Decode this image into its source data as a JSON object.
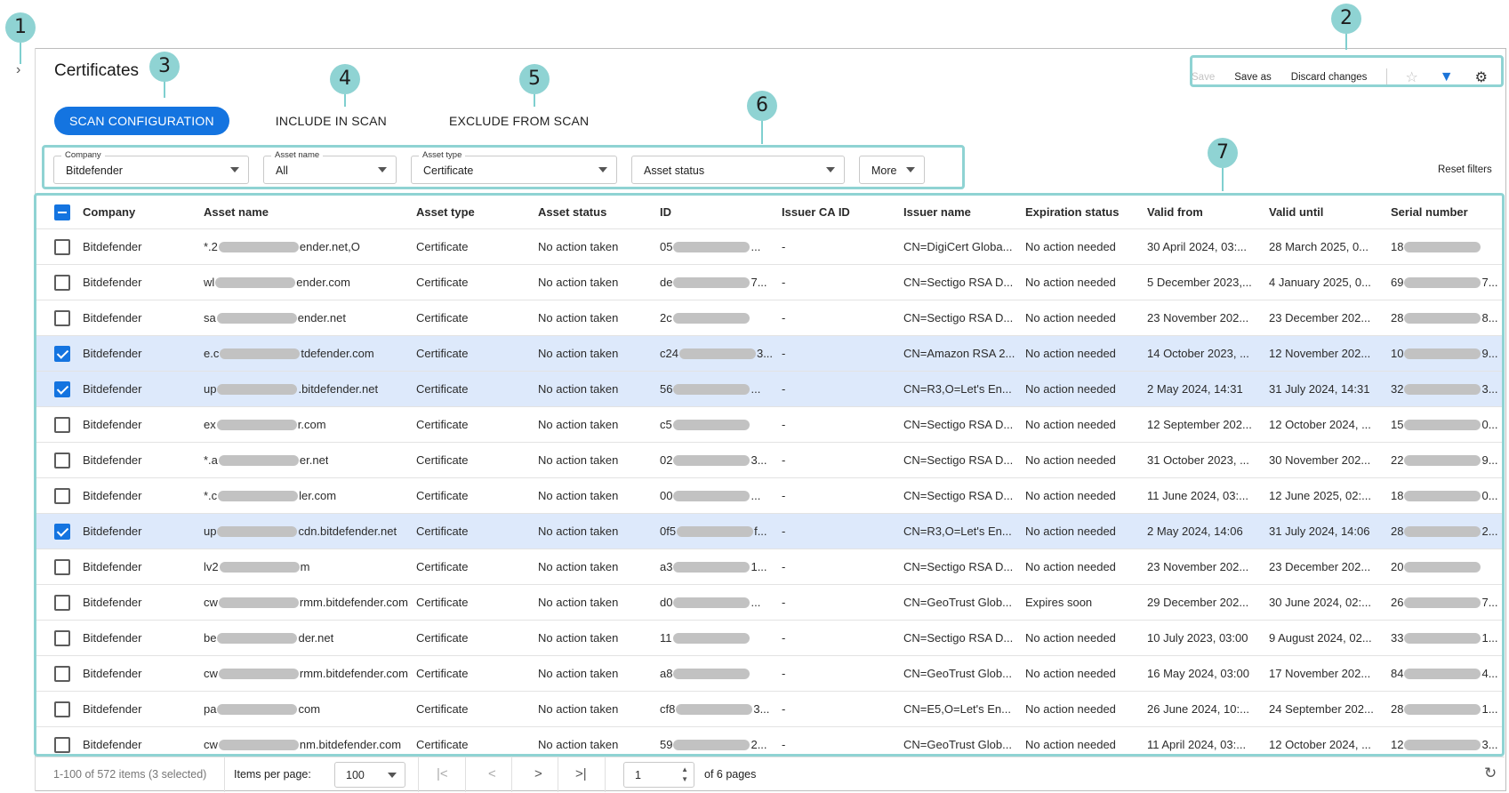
{
  "page": {
    "title": "Certificates"
  },
  "callouts": [
    "1",
    "2",
    "3",
    "4",
    "5",
    "6",
    "7"
  ],
  "toolbar": {
    "save": "Save",
    "save_as": "Save as",
    "discard": "Discard changes",
    "star_icon": "☆",
    "filter_icon": "▼",
    "settings_icon": "⚙"
  },
  "tabs": [
    {
      "label": "SCAN CONFIGURATION",
      "active": true
    },
    {
      "label": "INCLUDE IN SCAN",
      "active": false
    },
    {
      "label": "EXCLUDE FROM SCAN",
      "active": false
    }
  ],
  "filters": {
    "company": {
      "label": "Company",
      "value": "Bitdefender"
    },
    "asset_name": {
      "label": "Asset name",
      "value": "All"
    },
    "asset_type": {
      "label": "Asset type",
      "value": "Certificate"
    },
    "asset_status": {
      "value": "Asset status"
    },
    "more": {
      "value": "More"
    },
    "reset": "Reset filters"
  },
  "columns": [
    "Company",
    "Asset name",
    "Asset type",
    "Asset status",
    "ID",
    "Issuer CA ID",
    "Issuer name",
    "Expiration status",
    "Valid from",
    "Valid until",
    "Serial number"
  ],
  "rows": [
    {
      "selected": false,
      "company": "Bitdefender",
      "name_a": "*.2",
      "name_b": "ender.net,O",
      "type": "Certificate",
      "status": "No action taken",
      "id_a": "05",
      "id_b": "...",
      "issuer_ca": "-",
      "issuer": "CN=DigiCert Globa...",
      "exp": "No action needed",
      "from": "30 April 2024, 03:...",
      "until": "28 March 2025, 0...",
      "serial_a": "18",
      "serial_b": ""
    },
    {
      "selected": false,
      "company": "Bitdefender",
      "name_a": "wl",
      "name_b": "ender.com",
      "type": "Certificate",
      "status": "No action taken",
      "id_a": "de",
      "id_b": "7...",
      "issuer_ca": "-",
      "issuer": "CN=Sectigo RSA D...",
      "exp": "No action needed",
      "from": "5 December 2023,...",
      "until": "4 January 2025, 0...",
      "serial_a": "69",
      "serial_b": "7..."
    },
    {
      "selected": false,
      "company": "Bitdefender",
      "name_a": "sa",
      "name_b": "ender.net",
      "type": "Certificate",
      "status": "No action taken",
      "id_a": "2c",
      "id_b": "",
      "issuer_ca": "-",
      "issuer": "CN=Sectigo RSA D...",
      "exp": "No action needed",
      "from": "23 November 202...",
      "until": "23 December 202...",
      "serial_a": "28",
      "serial_b": "8..."
    },
    {
      "selected": true,
      "company": "Bitdefender",
      "name_a": "e.c",
      "name_b": "tdefender.com",
      "type": "Certificate",
      "status": "No action taken",
      "id_a": "c24",
      "id_b": "3...",
      "issuer_ca": "-",
      "issuer": "CN=Amazon RSA 2...",
      "exp": "No action needed",
      "from": "14 October 2023, ...",
      "until": "12 November 202...",
      "serial_a": "10",
      "serial_b": "9..."
    },
    {
      "selected": true,
      "company": "Bitdefender",
      "name_a": "up",
      "name_b": ".bitdefender.net",
      "type": "Certificate",
      "status": "No action taken",
      "id_a": "56",
      "id_b": "...",
      "issuer_ca": "-",
      "issuer": "CN=R3,O=Let's En...",
      "exp": "No action needed",
      "from": "2 May 2024, 14:31",
      "until": "31 July 2024, 14:31",
      "serial_a": "32",
      "serial_b": "3..."
    },
    {
      "selected": false,
      "company": "Bitdefender",
      "name_a": "ex",
      "name_b": "r.com",
      "type": "Certificate",
      "status": "No action taken",
      "id_a": "c5",
      "id_b": "",
      "issuer_ca": "-",
      "issuer": "CN=Sectigo RSA D...",
      "exp": "No action needed",
      "from": "12 September 202...",
      "until": "12 October 2024, ...",
      "serial_a": "15",
      "serial_b": "0..."
    },
    {
      "selected": false,
      "company": "Bitdefender",
      "name_a": "*.a",
      "name_b": "er.net",
      "type": "Certificate",
      "status": "No action taken",
      "id_a": "02",
      "id_b": "3...",
      "issuer_ca": "-",
      "issuer": "CN=Sectigo RSA D...",
      "exp": "No action needed",
      "from": "31 October 2023, ...",
      "until": "30 November 202...",
      "serial_a": "22",
      "serial_b": "9..."
    },
    {
      "selected": false,
      "company": "Bitdefender",
      "name_a": "*.c",
      "name_b": "ler.com",
      "type": "Certificate",
      "status": "No action taken",
      "id_a": "00",
      "id_b": "...",
      "issuer_ca": "-",
      "issuer": "CN=Sectigo RSA D...",
      "exp": "No action needed",
      "from": "11 June 2024, 03:...",
      "until": "12 June 2025, 02:...",
      "serial_a": "18",
      "serial_b": "0..."
    },
    {
      "selected": true,
      "company": "Bitdefender",
      "name_a": "up",
      "name_b": "cdn.bitdefender.net",
      "type": "Certificate",
      "status": "No action taken",
      "id_a": "0f5",
      "id_b": "f...",
      "issuer_ca": "-",
      "issuer": "CN=R3,O=Let's En...",
      "exp": "No action needed",
      "from": "2 May 2024, 14:06",
      "until": "31 July 2024, 14:06",
      "serial_a": "28",
      "serial_b": "2..."
    },
    {
      "selected": false,
      "company": "Bitdefender",
      "name_a": "lv2",
      "name_b": "m",
      "type": "Certificate",
      "status": "No action taken",
      "id_a": "a3",
      "id_b": "1...",
      "issuer_ca": "-",
      "issuer": "CN=Sectigo RSA D...",
      "exp": "No action needed",
      "from": "23 November 202...",
      "until": "23 December 202...",
      "serial_a": "20",
      "serial_b": ""
    },
    {
      "selected": false,
      "company": "Bitdefender",
      "name_a": "cw",
      "name_b": "rmm.bitdefender.com",
      "type": "Certificate",
      "status": "No action taken",
      "id_a": "d0",
      "id_b": "...",
      "issuer_ca": "-",
      "issuer": "CN=GeoTrust Glob...",
      "exp": "Expires soon",
      "from": "29 December 202...",
      "until": "30 June 2024, 02:...",
      "serial_a": "26",
      "serial_b": "7..."
    },
    {
      "selected": false,
      "company": "Bitdefender",
      "name_a": "be",
      "name_b": "der.net",
      "type": "Certificate",
      "status": "No action taken",
      "id_a": "11",
      "id_b": "",
      "issuer_ca": "-",
      "issuer": "CN=Sectigo RSA D...",
      "exp": "No action needed",
      "from": "10 July 2023, 03:00",
      "until": "9 August 2024, 02...",
      "serial_a": "33",
      "serial_b": "1..."
    },
    {
      "selected": false,
      "company": "Bitdefender",
      "name_a": "cw",
      "name_b": "rmm.bitdefender.com",
      "type": "Certificate",
      "status": "No action taken",
      "id_a": "a8",
      "id_b": "",
      "issuer_ca": "-",
      "issuer": "CN=GeoTrust Glob...",
      "exp": "No action needed",
      "from": "16 May 2024, 03:00",
      "until": "17 November 202...",
      "serial_a": "84",
      "serial_b": "4..."
    },
    {
      "selected": false,
      "company": "Bitdefender",
      "name_a": "pa",
      "name_b": "com",
      "type": "Certificate",
      "status": "No action taken",
      "id_a": "cf8",
      "id_b": "3...",
      "issuer_ca": "-",
      "issuer": "CN=E5,O=Let's En...",
      "exp": "No action needed",
      "from": "26 June 2024, 10:...",
      "until": "24 September 202...",
      "serial_a": "28",
      "serial_b": "1..."
    },
    {
      "selected": false,
      "company": "Bitdefender",
      "name_a": "cw",
      "name_b": "nm.bitdefender.com",
      "type": "Certificate",
      "status": "No action taken",
      "id_a": "59",
      "id_b": "2...",
      "issuer_ca": "-",
      "issuer": "CN=GeoTrust Glob...",
      "exp": "No action needed",
      "from": "11 April 2024, 03:...",
      "until": "12 October 2024, ...",
      "serial_a": "12",
      "serial_b": "3..."
    }
  ],
  "footer": {
    "items": "1-100 of 572 items (3 selected)",
    "per_page_label": "Items per page:",
    "per_page_value": "100",
    "first": "|<",
    "prev": "<",
    "next": ">",
    "last": ">|",
    "page_value": "1",
    "of_pages": "of 6 pages",
    "refresh_icon": "↻"
  },
  "colors": {
    "accent": "#1474e0",
    "callout": "#8fd3d3",
    "selected_row": "#dde9fb"
  }
}
